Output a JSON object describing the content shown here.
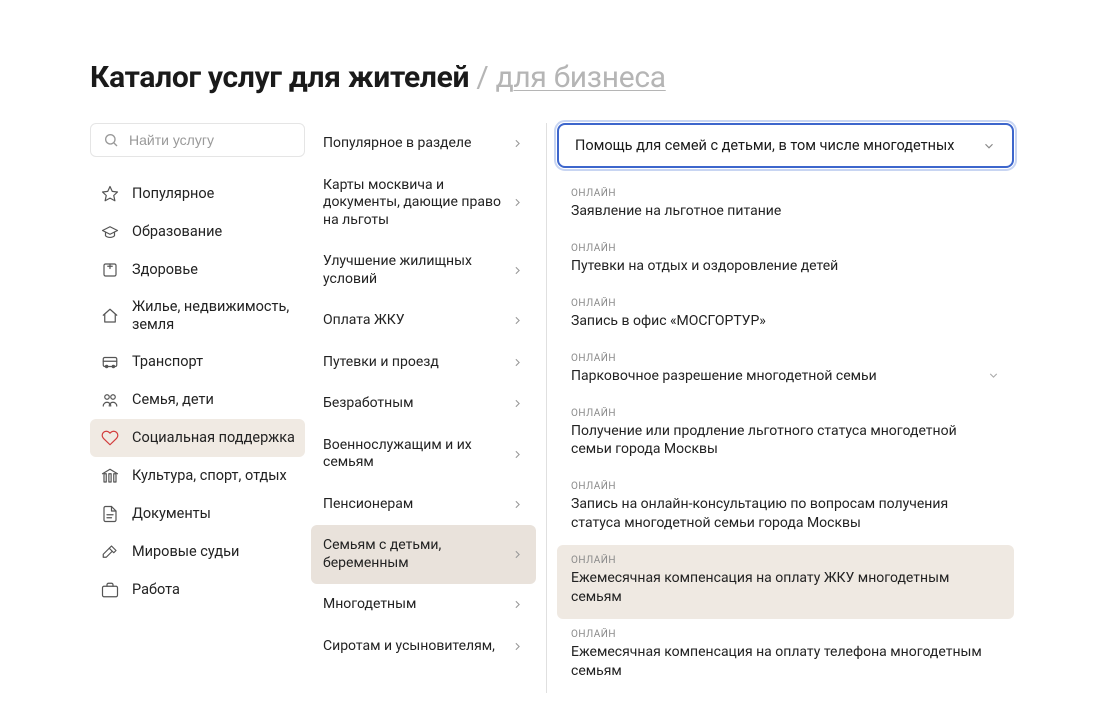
{
  "header": {
    "prefix": "Каталог услуг",
    "active_tab": "для жителей",
    "inactive_tab": "для бизнеса"
  },
  "search": {
    "placeholder": "Найти услугу"
  },
  "categories": [
    {
      "icon": "star",
      "label": "Популярное"
    },
    {
      "icon": "grad",
      "label": "Образование"
    },
    {
      "icon": "health",
      "label": "Здоровье"
    },
    {
      "icon": "home",
      "label": "Жилье, недвижимость, земля"
    },
    {
      "icon": "bus",
      "label": "Транспорт"
    },
    {
      "icon": "family",
      "label": "Семья, дети"
    },
    {
      "icon": "heart",
      "label": "Социальная поддержка"
    },
    {
      "icon": "culture",
      "label": "Культура, спорт, отдых"
    },
    {
      "icon": "doc",
      "label": "Документы"
    },
    {
      "icon": "hammer",
      "label": "Мировые судьи"
    },
    {
      "icon": "case",
      "label": "Работа"
    }
  ],
  "active_category_index": 6,
  "subcategories": [
    {
      "label": "Популярное в разделе"
    },
    {
      "label": "Карты москвича и документы, дающие право на льготы"
    },
    {
      "label": "Улучшение жилищных условий"
    },
    {
      "label": "Оплата ЖКУ"
    },
    {
      "label": "Путевки и проезд"
    },
    {
      "label": "Безработным"
    },
    {
      "label": "Военнослужащим и их семьям"
    },
    {
      "label": "Пенсионерам"
    },
    {
      "label": "Семьям с детьми, беременным"
    },
    {
      "label": "Многодетным"
    },
    {
      "label": "Сиротам и усыновителям,"
    }
  ],
  "active_subcategory_index": 8,
  "dropdown": {
    "selected": "Помощь для семей с детьми, в том числе многодетных"
  },
  "services": [
    {
      "badge": "ОНЛАЙН",
      "title": "Заявление на льготное питание",
      "hl": false,
      "expandable": false
    },
    {
      "badge": "ОНЛАЙН",
      "title": "Путевки на отдых и оздоровление детей",
      "hl": false,
      "expandable": false
    },
    {
      "badge": "ОНЛАЙН",
      "title": "Запись в офис «МОСГОРТУР»",
      "hl": false,
      "expandable": false
    },
    {
      "badge": "ОНЛАЙН",
      "title": "Парковочное разрешение многодетной семьи",
      "hl": false,
      "expandable": true
    },
    {
      "badge": "ОНЛАЙН",
      "title": "Получение или продление льготного статуса многодетной семьи города Москвы",
      "hl": false,
      "expandable": false
    },
    {
      "badge": "ОНЛАЙН",
      "title": "Запись на онлайн-консультацию по вопросам получения статуса многодетной семьи города Москвы",
      "hl": false,
      "expandable": false
    },
    {
      "badge": "ОНЛАЙН",
      "title": "Ежемесячная компенсация на оплату ЖКУ многодетным семьям",
      "hl": true,
      "expandable": false
    },
    {
      "badge": "ОНЛАЙН",
      "title": "Ежемесячная компенсация на оплату телефона многодетным семьям",
      "hl": false,
      "expandable": false
    }
  ]
}
